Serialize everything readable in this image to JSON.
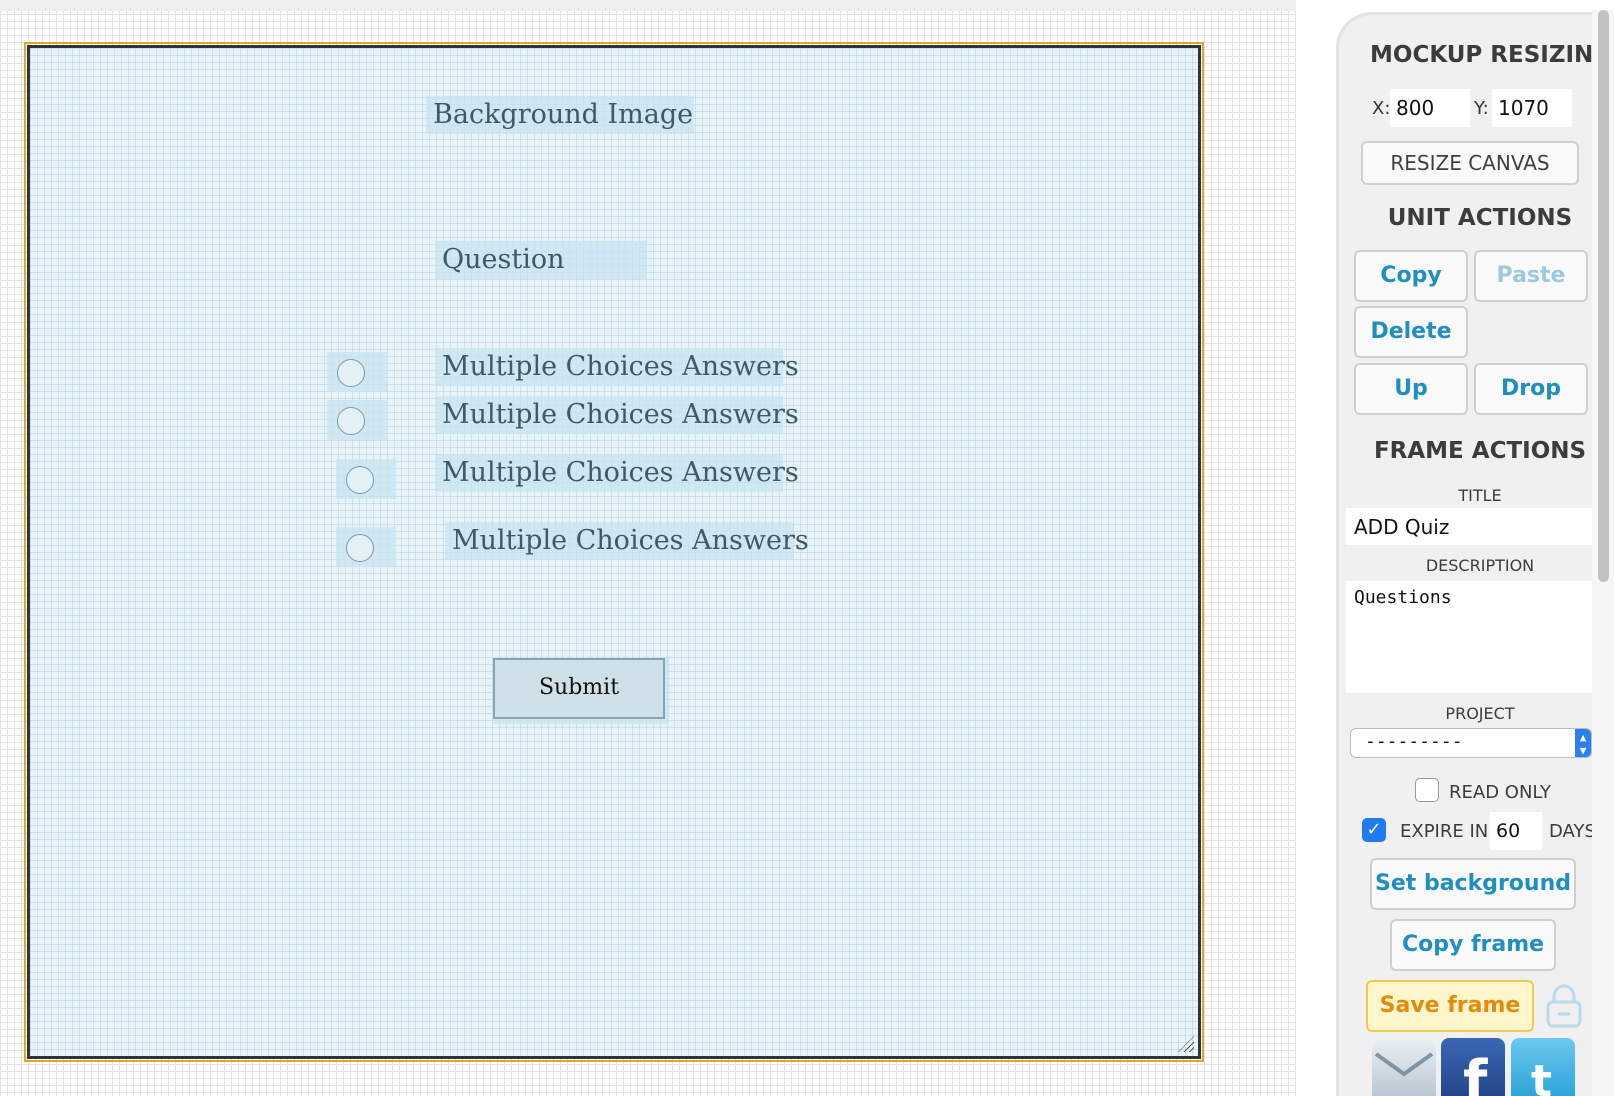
{
  "canvas": {
    "labels": {
      "background_image": "Background Image",
      "question": "Question",
      "answer_1": "Multiple Choices Answers",
      "answer_2": "Multiple Choices Answers",
      "answer_3": "Multiple Choices Answers",
      "answer_4": "Multiple Choices Answers"
    },
    "submit_label": "Submit"
  },
  "panel": {
    "mockup_resizing": {
      "heading": "MOCKUP RESIZING",
      "x_label": "X:",
      "x_value": "800",
      "y_label": "Y:",
      "y_value": "1070",
      "resize_button": "RESIZE CANVAS"
    },
    "unit_actions": {
      "heading": "UNIT ACTIONS",
      "copy": "Copy",
      "paste": "Paste",
      "delete": "Delete",
      "up": "Up",
      "drop": "Drop"
    },
    "frame_actions": {
      "heading": "FRAME ACTIONS",
      "title_label": "TITLE",
      "title_value": "ADD Quiz",
      "description_label": "DESCRIPTION",
      "description_value": "Questions",
      "project_label": "PROJECT",
      "project_value": "---------",
      "read_only_label": "READ ONLY",
      "read_only_checked": false,
      "expire_label": "EXPIRE IN",
      "expire_checked": true,
      "expire_days": "60",
      "days_label": "DAYS",
      "set_background": "Set background",
      "copy_frame": "Copy frame",
      "save_frame": "Save frame"
    },
    "share_icons": [
      "email-icon",
      "facebook-icon",
      "twitter-icon"
    ]
  },
  "colors": {
    "accent": "#1f8ec1",
    "save_text": "#e68a0a",
    "frame_border": "#e3a52e"
  }
}
